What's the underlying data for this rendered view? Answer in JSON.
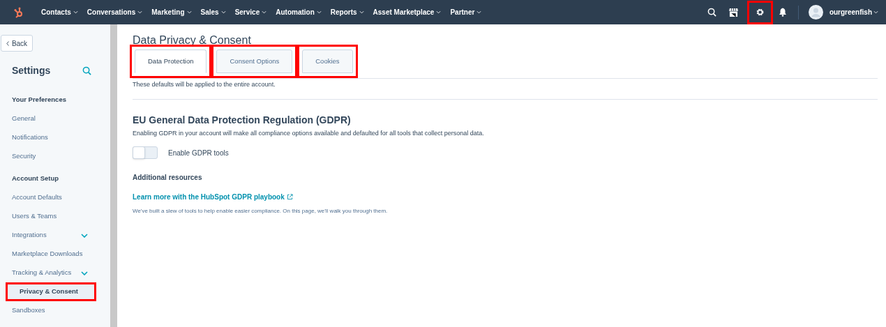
{
  "nav": {
    "items": [
      {
        "label": "Contacts"
      },
      {
        "label": "Conversations"
      },
      {
        "label": "Marketing"
      },
      {
        "label": "Sales"
      },
      {
        "label": "Service"
      },
      {
        "label": "Automation"
      },
      {
        "label": "Reports"
      },
      {
        "label": "Asset Marketplace"
      },
      {
        "label": "Partner"
      }
    ],
    "settings_highlighted": true,
    "account": "ourgreenfish"
  },
  "sidebar": {
    "back": "Back",
    "title": "Settings",
    "items": [
      {
        "kind": "heading",
        "label": "Your Preferences"
      },
      {
        "kind": "link",
        "label": "General",
        "selected": false,
        "expandable": false,
        "highlighted": false
      },
      {
        "kind": "link",
        "label": "Notifications",
        "selected": false,
        "expandable": false,
        "highlighted": false
      },
      {
        "kind": "link",
        "label": "Security",
        "selected": false,
        "expandable": false,
        "highlighted": false
      },
      {
        "kind": "heading",
        "label": "Account Setup"
      },
      {
        "kind": "link",
        "label": "Account Defaults",
        "selected": false,
        "expandable": false,
        "highlighted": false
      },
      {
        "kind": "link",
        "label": "Users & Teams",
        "selected": false,
        "expandable": false,
        "highlighted": false
      },
      {
        "kind": "link",
        "label": "Integrations",
        "selected": false,
        "expandable": true,
        "highlighted": false
      },
      {
        "kind": "link",
        "label": "Marketplace Downloads",
        "selected": false,
        "expandable": false,
        "highlighted": false
      },
      {
        "kind": "link",
        "label": "Tracking & Analytics",
        "selected": false,
        "expandable": true,
        "highlighted": false
      },
      {
        "kind": "link",
        "label": "Privacy & Consent",
        "selected": true,
        "expandable": false,
        "highlighted": true
      },
      {
        "kind": "link",
        "label": "Sandboxes",
        "selected": false,
        "expandable": false,
        "highlighted": false
      }
    ]
  },
  "page": {
    "title": "Data Privacy & Consent",
    "tabs": [
      {
        "label": "Data Protection",
        "selected": true,
        "highlighted": true
      },
      {
        "label": "Consent Options",
        "selected": false,
        "highlighted": true
      },
      {
        "label": "Cookies",
        "selected": false,
        "highlighted": true
      }
    ],
    "note": "These defaults will be applied to the entire account.",
    "section_title": "EU General Data Protection Regulation (GDPR)",
    "section_text": "Enabling GDPR in your account will make all compliance options available and defaulted for all tools that collect personal data.",
    "toggle": {
      "label": "Enable GDPR tools",
      "on": false
    },
    "resources_title": "Additional resources",
    "link": "Learn more with the HubSpot GDPR playbook",
    "link_text": "We've built a slew of tools to help enable easier compliance. On this page, we'll walk you through them."
  }
}
